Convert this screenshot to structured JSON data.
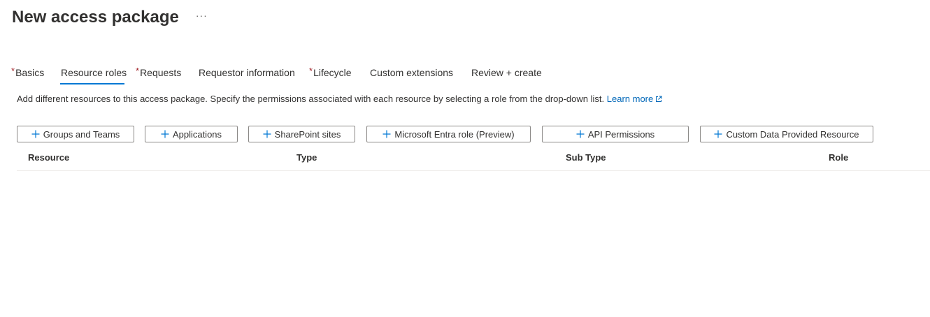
{
  "header": {
    "title": "New access package",
    "more_label": "···"
  },
  "tabs": [
    {
      "label": "Basics",
      "required": "*"
    },
    {
      "label": "Resource roles",
      "required": ""
    },
    {
      "label": "Requests",
      "required": "*"
    },
    {
      "label": "Requestor information",
      "required": ""
    },
    {
      "label": "Lifecycle",
      "required": "*"
    },
    {
      "label": "Custom extensions",
      "required": ""
    },
    {
      "label": "Review + create",
      "required": ""
    }
  ],
  "active_tab": "Resource roles",
  "description": {
    "text": "Add different resources to this access package. Specify the permissions associated with each resource by selecting a role from the drop-down list.",
    "link_label": "Learn more"
  },
  "toolbar": {
    "buttons": [
      {
        "label": "Groups and Teams",
        "icon": "plus-icon"
      },
      {
        "label": "Applications",
        "icon": "plus-icon"
      },
      {
        "label": "SharePoint sites",
        "icon": "plus-icon"
      },
      {
        "label": "Microsoft Entra role (Preview)",
        "icon": "plus-icon"
      },
      {
        "label": "API Permissions",
        "icon": "plus-icon"
      },
      {
        "label": "Custom Data Provided Resource",
        "icon": "plus-icon"
      }
    ]
  },
  "table": {
    "columns": [
      "Resource",
      "Type",
      "Sub Type",
      "Role"
    ],
    "rows": []
  },
  "colors": {
    "accent": "#0078d4",
    "link": "#0067b8",
    "required": "#a4262c",
    "border": "#8a8886"
  }
}
